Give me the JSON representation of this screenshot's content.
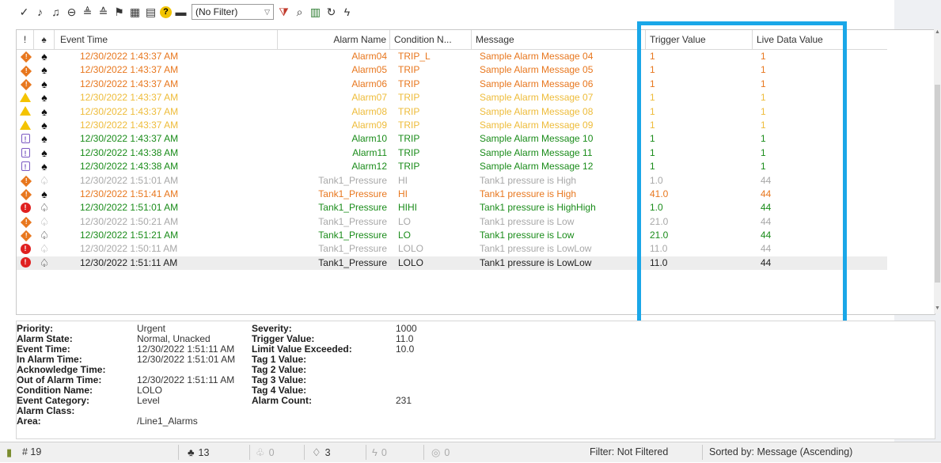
{
  "toolbar": {
    "icons": [
      "acknowledge-icon",
      "ack-selected-icon",
      "ack-all-icon",
      "shelve-icon",
      "sort-asc-icon",
      "sort-desc-icon",
      "user-filter-icon",
      "grid-icon",
      "document-icon",
      "help-icon",
      "print-icon",
      "filter-dropdown",
      "filter-funnel-icon",
      "search-icon",
      "table-icon",
      "refresh-icon",
      "freeze-icon"
    ],
    "filter_value": "(No Filter)"
  },
  "grid": {
    "columns": {
      "priority": "!",
      "bell": "",
      "event_time": "Event Time",
      "alarm_name": "Alarm Name",
      "condition": "Condition N...",
      "message": "Message",
      "trigger": "Trigger Value",
      "live": "Live Data Value"
    },
    "rows": [
      {
        "priority": "high",
        "bell": "ack",
        "time": "12/30/2022 1:43:37 AM",
        "name": "Alarm04",
        "cond": "TRIP_L",
        "msg": "Sample Alarm Message 04",
        "trig": "1",
        "live": "1",
        "color": "orange"
      },
      {
        "priority": "high",
        "bell": "ack",
        "time": "12/30/2022 1:43:37 AM",
        "name": "Alarm05",
        "cond": "TRIP",
        "msg": "Sample Alarm Message 05",
        "trig": "1",
        "live": "1",
        "color": "orange"
      },
      {
        "priority": "high",
        "bell": "ack",
        "time": "12/30/2022 1:43:37 AM",
        "name": "Alarm06",
        "cond": "TRIP",
        "msg": "Sample Alarm Message 06",
        "trig": "1",
        "live": "1",
        "color": "orange"
      },
      {
        "priority": "medium",
        "bell": "ack",
        "time": "12/30/2022 1:43:37 AM",
        "name": "Alarm07",
        "cond": "TRIP",
        "msg": "Sample Alarm Message 07",
        "trig": "1",
        "live": "1",
        "color": "yellow"
      },
      {
        "priority": "medium",
        "bell": "ack",
        "time": "12/30/2022 1:43:37 AM",
        "name": "Alarm08",
        "cond": "TRIP",
        "msg": "Sample Alarm Message 08",
        "trig": "1",
        "live": "1",
        "color": "yellow"
      },
      {
        "priority": "medium",
        "bell": "ack",
        "time": "12/30/2022 1:43:37 AM",
        "name": "Alarm09",
        "cond": "TRIP",
        "msg": "Sample Alarm Message 09",
        "trig": "1",
        "live": "1",
        "color": "yellow"
      },
      {
        "priority": "low",
        "bell": "ack",
        "time": "12/30/2022 1:43:37 AM",
        "name": "Alarm10",
        "cond": "TRIP",
        "msg": "Sample Alarm Message 10",
        "trig": "1",
        "live": "1",
        "color": "green"
      },
      {
        "priority": "low",
        "bell": "ack",
        "time": "12/30/2022 1:43:38 AM",
        "name": "Alarm11",
        "cond": "TRIP",
        "msg": "Sample Alarm Message 11",
        "trig": "1",
        "live": "1",
        "color": "green"
      },
      {
        "priority": "low",
        "bell": "ack",
        "time": "12/30/2022 1:43:38 AM",
        "name": "Alarm12",
        "cond": "TRIP",
        "msg": "Sample Alarm Message 12",
        "trig": "1",
        "live": "1",
        "color": "green"
      },
      {
        "priority": "high",
        "bell": "unack",
        "time": "12/30/2022 1:51:01 AM",
        "name": "Tank1_Pressure",
        "cond": "HI",
        "msg": "Tank1 pressure is High",
        "trig": "1.0",
        "live": "44",
        "color": "gray"
      },
      {
        "priority": "high",
        "bell": "ack",
        "time": "12/30/2022 1:51:41 AM",
        "name": "Tank1_Pressure",
        "cond": "HI",
        "msg": "Tank1 pressure is High",
        "trig": "41.0",
        "live": "44",
        "color": "orange"
      },
      {
        "priority": "urgent",
        "bell": "active",
        "time": "12/30/2022 1:51:01 AM",
        "name": "Tank1_Pressure",
        "cond": "HIHI",
        "msg": "Tank1 pressure is HighHigh",
        "trig": "1.0",
        "live": "44",
        "color": "green"
      },
      {
        "priority": "high",
        "bell": "unack",
        "time": "12/30/2022 1:50:21 AM",
        "name": "Tank1_Pressure",
        "cond": "LO",
        "msg": "Tank1 pressure is Low",
        "trig": "21.0",
        "live": "44",
        "color": "gray"
      },
      {
        "priority": "high",
        "bell": "active",
        "time": "12/30/2022 1:51:21 AM",
        "name": "Tank1_Pressure",
        "cond": "LO",
        "msg": "Tank1 pressure is Low",
        "trig": "21.0",
        "live": "44",
        "color": "green"
      },
      {
        "priority": "urgent",
        "bell": "unack",
        "time": "12/30/2022 1:50:11 AM",
        "name": "Tank1_Pressure",
        "cond": "LOLO",
        "msg": "Tank1 pressure is LowLow",
        "trig": "11.0",
        "live": "44",
        "color": "gray"
      },
      {
        "priority": "urgent",
        "bell": "active",
        "time": "12/30/2022 1:51:11 AM",
        "name": "Tank1_Pressure",
        "cond": "LOLO",
        "msg": "Tank1 pressure is LowLow",
        "trig": "11.0",
        "live": "44",
        "color": "dark",
        "selected": true
      }
    ]
  },
  "details": {
    "col1": [
      {
        "label": "Priority:",
        "value": "Urgent"
      },
      {
        "label": "Alarm State:",
        "value": "Normal, Unacked"
      },
      {
        "label": "Event Time:",
        "value": "12/30/2022 1:51:11 AM"
      },
      {
        "label": "In Alarm Time:",
        "value": "12/30/2022 1:51:01 AM"
      },
      {
        "label": "Acknowledge Time:",
        "value": ""
      },
      {
        "label": "Out of Alarm Time:",
        "value": "12/30/2022 1:51:11 AM"
      },
      {
        "label": "Condition Name:",
        "value": "LOLO"
      },
      {
        "label": "Event Category:",
        "value": "Level"
      },
      {
        "label": "Alarm Class:",
        "value": ""
      },
      {
        "label": "Area:",
        "value": "/Line1_Alarms"
      }
    ],
    "col2": [
      {
        "label": "Severity:",
        "value": "1000"
      },
      {
        "label": "Trigger Value:",
        "value": "11.0"
      },
      {
        "label": "Limit Value Exceeded:",
        "value": "10.0"
      },
      {
        "label": "Tag 1 Value:",
        "value": ""
      },
      {
        "label": "Tag 2 Value:",
        "value": ""
      },
      {
        "label": "Tag 3 Value:",
        "value": ""
      },
      {
        "label": "Tag 4 Value:",
        "value": ""
      },
      {
        "label": "Alarm Count:",
        "value": "231"
      }
    ]
  },
  "statusbar": {
    "total": "# 19",
    "active_count": "13",
    "unack_count": "0",
    "inactive_count": "3",
    "shelved_count": "0",
    "disabled_count": "0",
    "filter": "Filter: Not Filtered",
    "sorted": "Sorted by: Message (Ascending)"
  },
  "colors": {
    "orange": "#e8771e",
    "yellow": "#eebc3a",
    "green": "#1a8c1a",
    "gray": "#a8a8a8",
    "urgent": "#e02020",
    "highlight": "#1aa7e8"
  }
}
